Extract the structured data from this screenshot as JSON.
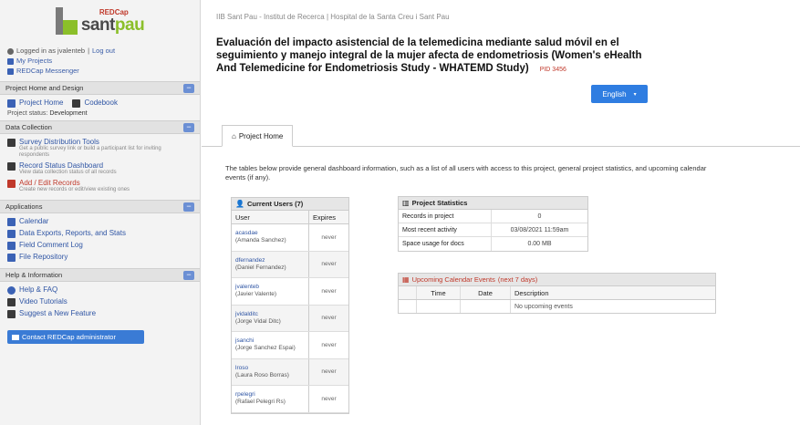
{
  "sidebar": {
    "logo": {
      "badge": "REDCap",
      "brand_part1": "sant",
      "brand_part2": "pau"
    },
    "top_links": {
      "logged_in": "Logged in as jvalenteb",
      "logout": "Log out",
      "my_projects": "My Projects",
      "redcap_messenger": "REDCap Messenger"
    },
    "sections": {
      "project_home": {
        "title": "Project Home and Design",
        "project_home": "Project Home",
        "codebook": "Codebook",
        "status_label": "Project status:",
        "status_value": "Development"
      },
      "data_collection": {
        "title": "Data Collection",
        "survey_tools": "Survey Distribution Tools",
        "survey_tools_sub": "Get a public survey link or build a participant list for inviting respondents",
        "record_status": "Record Status Dashboard",
        "record_status_sub": "View data collection status of all records",
        "add_edit": "Add / Edit Records",
        "add_edit_sub": "Create new records or edit/view existing ones"
      },
      "applications": {
        "title": "Applications",
        "calendar": "Calendar",
        "data_exports": "Data Exports, Reports, and Stats",
        "logging": "Field Comment Log",
        "file_repository": "File Repository"
      },
      "help": {
        "title": "Help & Information",
        "faq": "Help & FAQ",
        "video": "Video Tutorials",
        "suggest": "Suggest a New Feature"
      },
      "collapse_symbol": "−"
    },
    "contact_button": "Contact REDCap administrator"
  },
  "main": {
    "breadcrumb": "IIB Sant Pau - Institut de Recerca | Hospital de la Santa Creu i Sant Pau",
    "title": "Evaluación del impacto asistencial de la telemedicina mediante salud móvil en el seguimiento y manejo integral de la mujer afecta de endometriosis (Women's eHealth And Telemedicine for Endometriosis Study - WHATEMD Study)",
    "pid": "PID 3456",
    "language_button": "English",
    "tab_label": "Project Home",
    "intro": "The tables below provide general dashboard information, such as a list of all users with access to this project, general project statistics, and upcoming calendar events (if any).",
    "users_table": {
      "title": "Current Users (7)",
      "col_user": "User",
      "col_expires": "Expires",
      "rows": [
        {
          "username": "acasdae",
          "name": "(Amanda Sanchez)",
          "expires": "never"
        },
        {
          "username": "dfernandez",
          "name": "(Daniel Fernandez)",
          "expires": "never"
        },
        {
          "username": "jvalenteb",
          "name": "(Javier Valente)",
          "expires": "never"
        },
        {
          "username": "jvidalditc",
          "name": "(Jorge Vidal Ditc)",
          "expires": "never"
        },
        {
          "username": "jsanchi",
          "name": "(Jorge Sanchez Espai)",
          "expires": "never"
        },
        {
          "username": "lroso",
          "name": "(Laura Roso Borras)",
          "expires": "never"
        },
        {
          "username": "rpelegri",
          "name": "(Rafael Pelegri Rs)",
          "expires": "never"
        }
      ]
    },
    "stats_table": {
      "title": "Project Statistics",
      "rows": [
        {
          "key": "Records in project",
          "value": "0"
        },
        {
          "key": "Most recent activity",
          "value": "03/08/2021 11:59am"
        },
        {
          "key": "Space usage for docs",
          "value": "0.00 MB"
        }
      ]
    },
    "calendar_table": {
      "title": "Upcoming Calendar Events",
      "range": "(next 7 days)",
      "col_time": "Time",
      "col_date": "Date",
      "col_desc": "Description",
      "empty_text": "No upcoming events"
    }
  }
}
